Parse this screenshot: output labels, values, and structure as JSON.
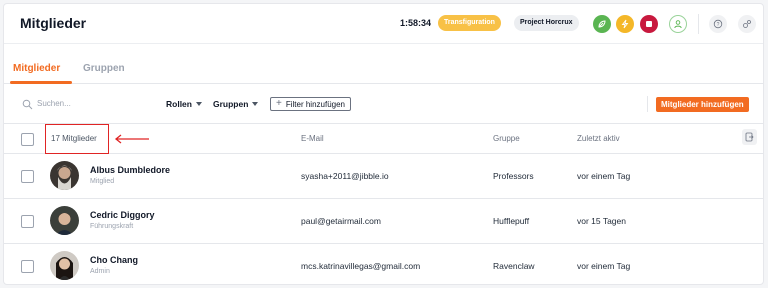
{
  "header": {
    "title": "Mitglieder",
    "timer": "1:58:34",
    "activity_tag": "Transfiguration",
    "project_tag": "Project Horcrux",
    "colors": {
      "accent": "#f26b21",
      "activity": "#f8c146",
      "green": "#5ab552",
      "yellow": "#f4b728",
      "red": "#c8193e"
    },
    "icons": [
      "leaf-icon",
      "lightning-icon",
      "stop-icon",
      "user-icon",
      "help-icon",
      "settings-icon"
    ]
  },
  "tabs": [
    {
      "label": "Mitglieder",
      "active": true
    },
    {
      "label": "Gruppen",
      "active": false
    }
  ],
  "toolbar": {
    "search_placeholder": "Suchen...",
    "roles_label": "Rollen",
    "groups_label": "Gruppen",
    "filter_label": "Filter hinzufügen",
    "add_label": "Mitglieder hinzufügen"
  },
  "table": {
    "member_count": "17 Mitglieder",
    "columns": {
      "email": "E-Mail",
      "group": "Gruppe",
      "last_active": "Zuletzt aktiv"
    },
    "rows": [
      {
        "name": "Albus Dumbledore",
        "role": "Mitglied",
        "email": "syasha+2011@jibble.io",
        "group": "Professors",
        "last_active": "vor einem Tag"
      },
      {
        "name": "Cedric Diggory",
        "role": "Führungskraft",
        "email": "paul@getairmail.com",
        "group": "Hufflepuff",
        "last_active": "vor 15 Tagen"
      },
      {
        "name": "Cho Chang",
        "role": "Admin",
        "email": "mcs.katrinavillegas@gmail.com",
        "group": "Ravenclaw",
        "last_active": "vor einem Tag"
      }
    ]
  }
}
